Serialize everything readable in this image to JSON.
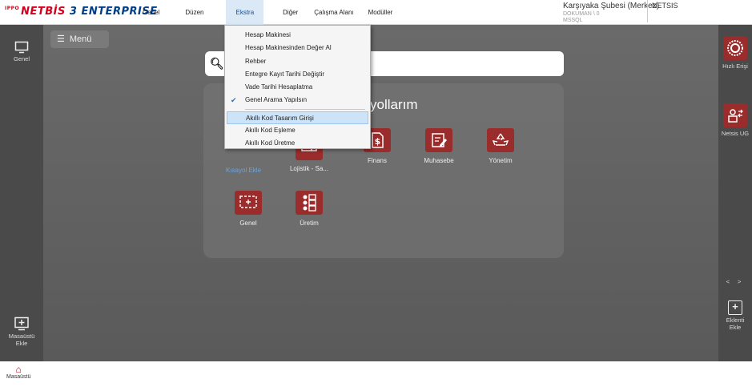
{
  "logo": {
    "prefix": "IPPO",
    "text1": "NETBİS",
    "num": "3",
    "text2": "ENTERPRISE"
  },
  "menubar": [
    {
      "label": "Genel",
      "active": false
    },
    {
      "label": "Düzen",
      "active": false
    },
    {
      "label": "Ekstra",
      "active": true
    },
    {
      "label": "Diğer",
      "active": false
    },
    {
      "label": "Çalışma Alanı",
      "active": false
    },
    {
      "label": "Modüller",
      "active": false
    }
  ],
  "branch": {
    "name": "Karşıyaka Şubesi (Merkez)",
    "line2": "DOKUMAN \\ 0",
    "line3": "MSSQL"
  },
  "user": "NETSIS",
  "left_sidebar": {
    "genel": "Genel",
    "masaustu_line1": "Masaüstü",
    "masaustu_line2": "Ekle"
  },
  "right_sidebar": {
    "hizli": "Hızlı Erişi",
    "netsis": "Netsis UG",
    "nav": "<  >",
    "eklenti_line1": "Eklenti",
    "eklenti_line2": "Ekle"
  },
  "menu_button": "Menü",
  "panel": {
    "title": "yollarım",
    "add_shortcut": "Kısayol Ekle",
    "tiles_row1": [
      {
        "label": "Lojistik - Sa...",
        "icon": "truck-icon"
      },
      {
        "label": "Finans",
        "icon": "dollar-doc-icon"
      },
      {
        "label": "Muhasebe",
        "icon": "ledger-edit-icon"
      },
      {
        "label": "Yönetim",
        "icon": "recycle-icon"
      }
    ],
    "tiles_row2": [
      {
        "label": "Genel",
        "icon": "screen-icon"
      },
      {
        "label": "Üretim",
        "icon": "checklist-icon"
      }
    ]
  },
  "dropdown": {
    "group1": [
      {
        "label": "Hesap Makinesi",
        "checked": false
      },
      {
        "label": "Hesap Makinesinden Değer Al",
        "checked": false
      },
      {
        "label": "Rehber",
        "checked": false
      },
      {
        "label": "Entegre Kayıt Tarihi Değiştir",
        "checked": false
      },
      {
        "label": "Vade Tarihi Hesaplatma",
        "checked": false
      },
      {
        "label": "Genel Arama Yapılsın",
        "checked": true
      }
    ],
    "group2": [
      {
        "label": "Akıllı Kod Tasarım Girişi",
        "highlighted": true
      },
      {
        "label": "Akıllı Kod Eşleme",
        "highlighted": false
      },
      {
        "label": "Akıllı Kod Üretme",
        "highlighted": false
      }
    ]
  },
  "bottom": {
    "home_label": "Masaüstü"
  },
  "colors": {
    "brand_red": "#d0001c",
    "brand_blue": "#003f87",
    "tile_red": "#9a2c2c",
    "highlight": "#cde3f7"
  }
}
